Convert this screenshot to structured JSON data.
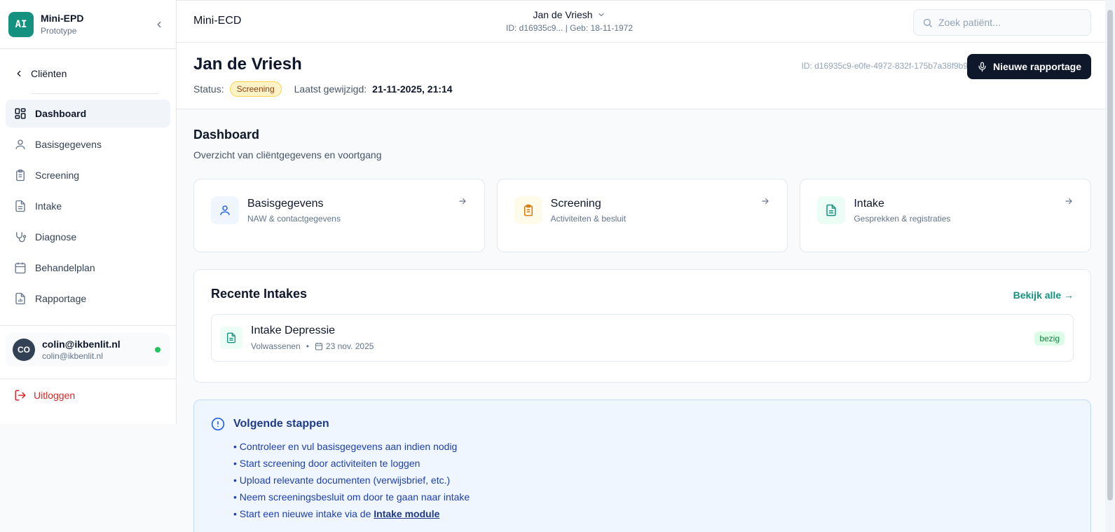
{
  "brand": {
    "logo": "AI",
    "name": "Mini-EPD",
    "subtitle": "Prototype"
  },
  "sidebar": {
    "back_label": "Cliënten",
    "items": [
      {
        "label": "Dashboard",
        "icon": "dashboard-icon",
        "active": true
      },
      {
        "label": "Basisgegevens",
        "icon": "user-icon"
      },
      {
        "label": "Screening",
        "icon": "clipboard-icon"
      },
      {
        "label": "Intake",
        "icon": "file-text-icon"
      },
      {
        "label": "Diagnose",
        "icon": "stethoscope-icon"
      },
      {
        "label": "Behandelplan",
        "icon": "calendar-icon"
      },
      {
        "label": "Rapportage",
        "icon": "report-icon"
      }
    ],
    "user": {
      "initials": "CO",
      "name": "colin@ikbenlit.nl",
      "email": "colin@ikbenlit.nl",
      "status_color": "#22c55e"
    },
    "logout_label": "Uitloggen"
  },
  "topbar": {
    "title": "Mini-ECD",
    "patient_name": "Jan de Vriesh",
    "patient_meta": "ID: d16935c9... | Geb: 18-11-1972",
    "search_placeholder": "Zoek patiënt..."
  },
  "header": {
    "name": "Jan de Vriesh",
    "status_label": "Status:",
    "status_value": "Screening",
    "modified_label": "Laatst gewijzigd:",
    "modified_value": "21-11-2025, 21:14",
    "id_text": "ID: d16935c9-e0fe-4972-832f-175b7a38f9b9",
    "new_report_label": "Nieuwe rapportage"
  },
  "dashboard": {
    "title": "Dashboard",
    "subtitle": "Overzicht van cliëntgegevens en voortgang",
    "cards": [
      {
        "title": "Basisgegevens",
        "subtitle": "NAW & contactgegevens",
        "icon": "user-icon",
        "color": "#2563eb",
        "bg": "#eff6ff"
      },
      {
        "title": "Screening",
        "subtitle": "Activiteiten & besluit",
        "icon": "clipboard-icon",
        "color": "#d97706",
        "bg": "#fffbeb"
      },
      {
        "title": "Intake",
        "subtitle": "Gesprekken & registraties",
        "icon": "file-text-icon",
        "color": "#14917f",
        "bg": "#ecfdf5"
      }
    ]
  },
  "recent": {
    "title": "Recente Intakes",
    "view_all": "Bekijk alle →",
    "items": [
      {
        "title": "Intake Depressie",
        "category": "Volwassenen",
        "date": "23 nov. 2025",
        "status": "bezig"
      }
    ]
  },
  "steps": {
    "title": "Volgende stappen",
    "items": [
      "• Controleer en vul basisgegevens aan indien nodig",
      "• Start screening door activiteiten te loggen",
      "• Upload relevante documenten (verwijsbrief, etc.)",
      "• Neem screeningsbesluit om door te gaan naar intake"
    ],
    "last_prefix": "• Start een nieuwe intake via de ",
    "last_link": "Intake module"
  },
  "colors": {
    "accent": "#14917f",
    "primary_button": "#0f172a",
    "logout": "#dc2626"
  }
}
